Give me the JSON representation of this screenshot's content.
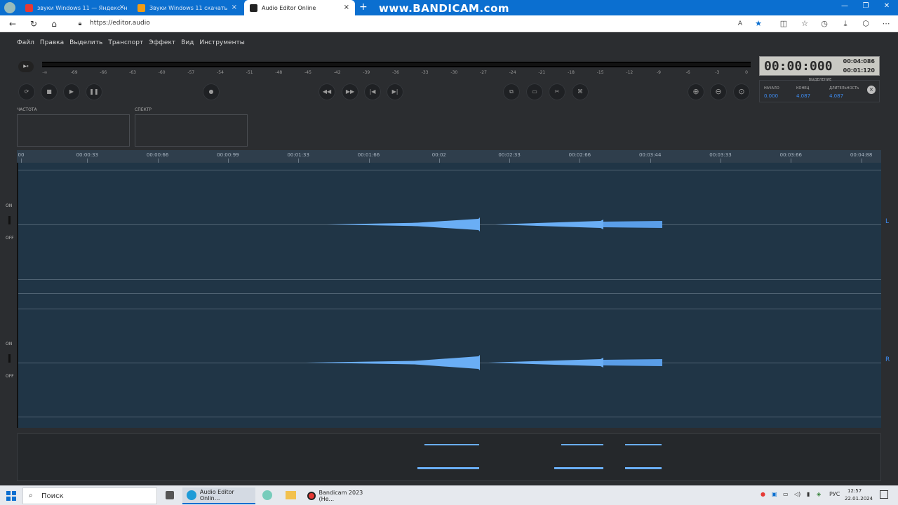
{
  "browser": {
    "tabs": [
      {
        "label": "звуки Windows 11 — Яндекс: н",
        "active": false
      },
      {
        "label": "Звуки Windows 11 скачать",
        "active": false
      },
      {
        "label": "Audio Editor Online",
        "active": true
      }
    ],
    "watermark": "www.BANDICAM.com",
    "url": "https://editor.audio",
    "icons": [
      "back-icon",
      "refresh-icon",
      "home-icon",
      "lock-icon",
      "read-aloud-icon",
      "favorite-star-icon",
      "split-screen-icon",
      "favorites-icon",
      "history-icon",
      "downloads-icon",
      "extensions-icon",
      "more-icon"
    ]
  },
  "menu": [
    "Файл",
    "Правка",
    "Выделить",
    "Транспорт",
    "Эффект",
    "Вид",
    "Инструменты"
  ],
  "meter": {
    "ticks": [
      "-∞",
      "-69",
      "-66",
      "-63",
      "-60",
      "-57",
      "-54",
      "-51",
      "-48",
      "-45",
      "-42",
      "-39",
      "-36",
      "-33",
      "-30",
      "-27",
      "-24",
      "-21",
      "-18",
      "-15",
      "-12",
      "-9",
      "-6",
      "-3",
      "0"
    ],
    "play_mini": "▶⏸"
  },
  "transport": {
    "loop": "⟳",
    "stop": "■",
    "play": "▶",
    "pause": "❚❚",
    "record": "●",
    "rewind": "◀◀",
    "forward": "▶▶",
    "to_start": "|◀",
    "to_end": "▶|",
    "copy": "⧉",
    "paste": "▭",
    "cut": "✂",
    "trim": "⌘",
    "zoom_in": "⊕",
    "zoom_out": "⊖",
    "zoom_sel": "⊙"
  },
  "time": {
    "main": "00:00:000",
    "total": "00:04:086",
    "selection_time": "00:01:120"
  },
  "selection": {
    "title": "ВЫДЕЛЕНИЕ",
    "start_label": "НАЧАЛО",
    "start": "0.000",
    "end_label": "КОНЕЦ",
    "end": "4.087",
    "length_label": "ДЛИТЕЛЬНОСТЬ",
    "length": "4.087",
    "close": "×"
  },
  "panels": {
    "frequency": "ЧАСТОТА",
    "spectrum": "СПЕКТР"
  },
  "ruler": [
    "00",
    "00:00:33",
    "00:00:66",
    "00:00:99",
    "00:01:33",
    "00:01:66",
    "00:02",
    "00:02:33",
    "00:02:66",
    "00:03:44",
    "00:03:33",
    "00:03:66",
    "00:04:88"
  ],
  "tracks": {
    "on": "ON",
    "off": "OFF",
    "left": "L",
    "right": "R"
  },
  "taskbar": {
    "search": "Поиск",
    "apps": [
      {
        "label": "Audio Editor Onlin...",
        "active": true
      },
      {
        "label": "Bandicam 2023 (Не...",
        "active": false
      }
    ],
    "lang": "РУС",
    "time": "12:57",
    "date": "22.01.2024"
  },
  "colors": {
    "accent": "#0b6fd0",
    "waveform": "#6aaef5",
    "track_bg": "#203546"
  }
}
